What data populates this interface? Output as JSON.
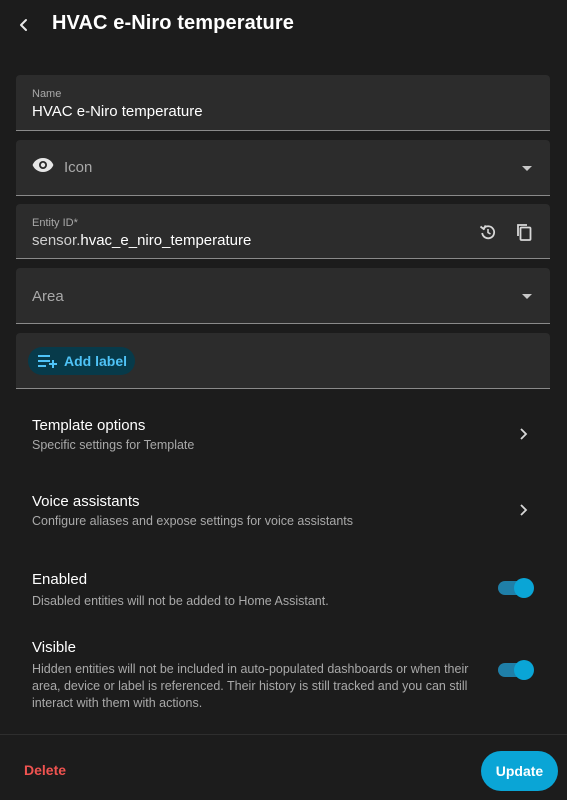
{
  "header": {
    "title": "HVAC e-Niro temperature"
  },
  "name_field": {
    "label": "Name",
    "value": "HVAC e-Niro temperature"
  },
  "icon_field": {
    "placeholder": "Icon",
    "icon": "eye-icon"
  },
  "entity_id_field": {
    "label": "Entity ID*",
    "prefix": "sensor.",
    "value": "hvac_e_niro_temperature"
  },
  "area_field": {
    "placeholder": "Area"
  },
  "labels": {
    "add_label": "Add label"
  },
  "template_options": {
    "title": "Template options",
    "subtitle": "Specific settings for Template"
  },
  "voice_assistants": {
    "title": "Voice assistants",
    "subtitle": "Configure aliases and expose settings for voice assistants"
  },
  "enabled": {
    "title": "Enabled",
    "subtitle": "Disabled entities will not be added to Home Assistant.",
    "checked": true
  },
  "visible": {
    "title": "Visible",
    "subtitle_line1": "Hidden entities will not be included in auto-populated dashboards or when their",
    "subtitle_line2": "area, device or label is referenced. Their history is still tracked and you can still",
    "subtitle_line3": "interact with them with actions.",
    "checked": true
  },
  "footer": {
    "delete_label": "Delete",
    "update_label": "Update"
  },
  "colors": {
    "accent": "#0aa5d6",
    "danger": "#ef5350",
    "chip_text": "#4fc3f7"
  }
}
